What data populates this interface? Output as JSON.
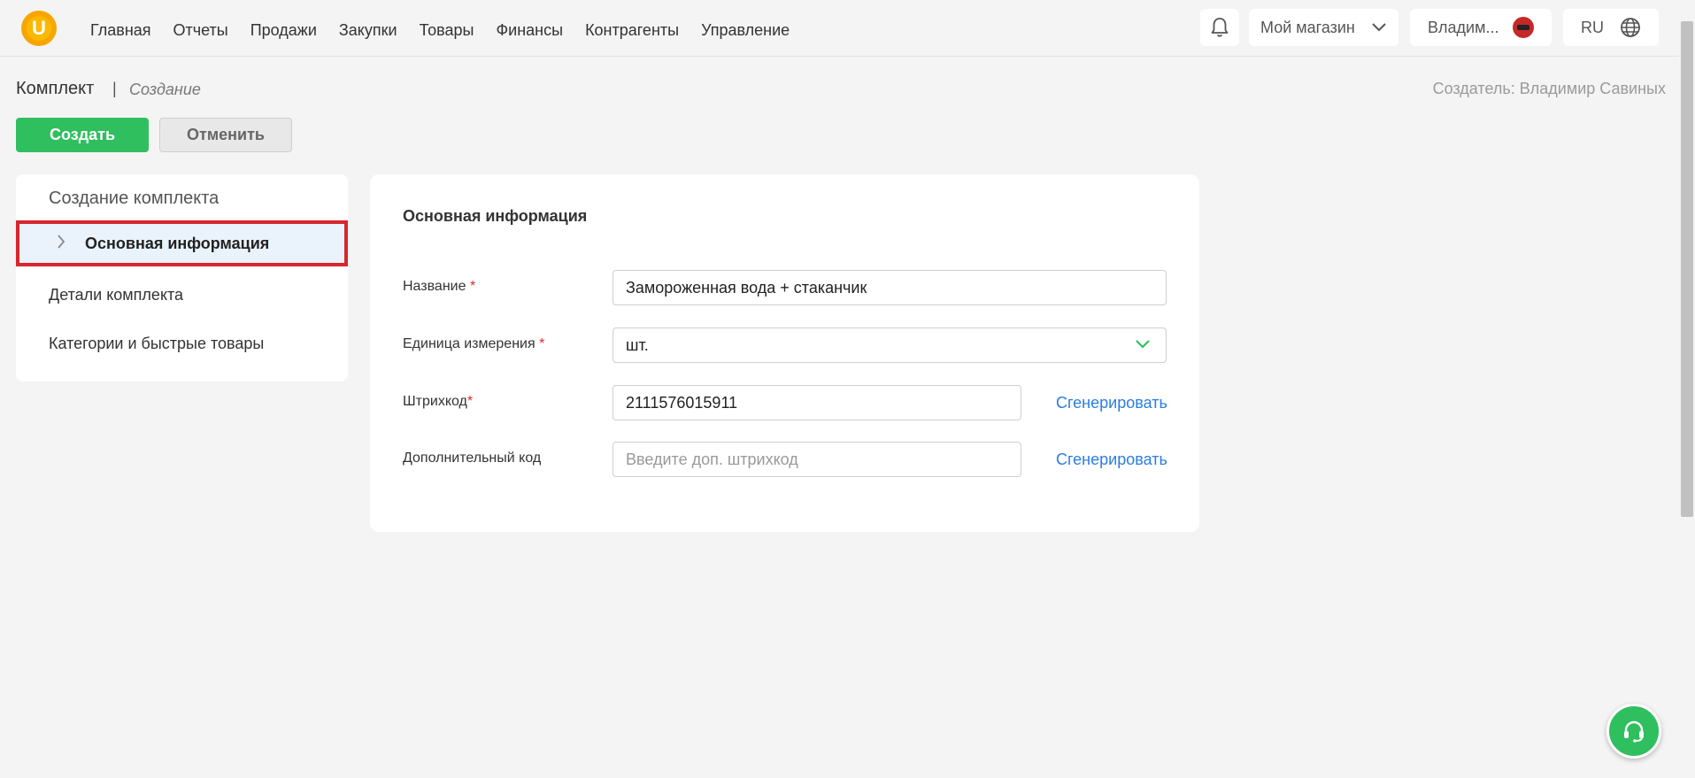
{
  "header": {
    "logo_letter": "U",
    "nav": [
      "Главная",
      "Отчеты",
      "Продажи",
      "Закупки",
      "Товары",
      "Финансы",
      "Контрагенты",
      "Управление"
    ],
    "store": "Мой магазин",
    "user": "Владим...",
    "lang": "RU"
  },
  "page": {
    "title": "Комплект",
    "separator": "|",
    "subtitle": "Создание",
    "creator": "Создатель: Владимир Савиных",
    "create_button": "Создать",
    "cancel_button": "Отменить"
  },
  "sidebar": {
    "title": "Создание комплекта",
    "items": [
      {
        "label": "Основная информация",
        "active": true
      },
      {
        "label": "Детали комплекта",
        "active": false
      },
      {
        "label": "Категории и быстрые товары",
        "active": false
      }
    ]
  },
  "form": {
    "title": "Основная информация",
    "name_label": "Название",
    "name_value": "Замороженная вода + стаканчик",
    "unit_label": "Единица измерения",
    "unit_value": "шт.",
    "barcode_label": "Штрихкод",
    "barcode_value": "2111576015911",
    "barcode_generate": "Сгенерировать",
    "extra_code_label": "Дополнительный код",
    "extra_code_placeholder": "Введите доп. штрихкод",
    "extra_code_generate": "Сгенерировать",
    "required_mark": "*"
  },
  "colors": {
    "accent_green": "#2fbf5f",
    "link_blue": "#2b7de0",
    "highlight_red": "#d7262d",
    "logo_orange": "#f7a600"
  }
}
